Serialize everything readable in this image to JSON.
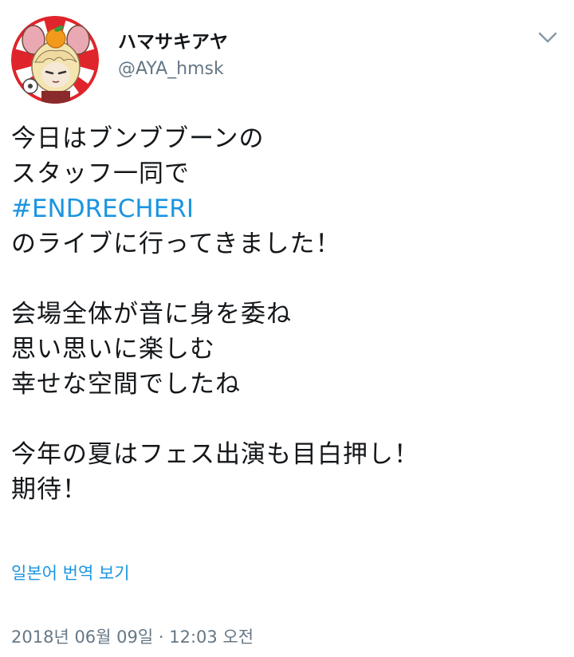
{
  "user": {
    "display_name": "ハマサキアヤ",
    "handle": "@AYA_hmsk",
    "avatar_icon": "profile-avatar",
    "avatar_colors": {
      "ring_red": "#e0242b",
      "ring_white": "#ffffff",
      "hair": "#f3e4b0",
      "orange": "#f29a1c",
      "leaf": "#3a9b3a",
      "ear": "#e9a8b2"
    }
  },
  "menu": {
    "icon": "chevron-down-icon",
    "color": "#8899a6"
  },
  "tweet": {
    "lines": [
      {
        "text": "今日はブンブブーンの"
      },
      {
        "text": "スタッフ一同で"
      },
      {
        "hashtag": "#ENDRECHERI"
      },
      {
        "text": "のライブに行ってきました！"
      },
      {
        "blank": true
      },
      {
        "text": "会場全体が音に身を委ね"
      },
      {
        "text": "思い思いに楽しむ"
      },
      {
        "text": "幸せな空間でしたね"
      },
      {
        "blank": true
      },
      {
        "text": "今年の夏はフェス出演も目白押し！"
      },
      {
        "text": "期待！"
      }
    ],
    "hashtag_color": "#1b95e0"
  },
  "translate": {
    "label": "일본어 번역 보기"
  },
  "timestamp": {
    "text": "2018년 06월 09일 · 12:03 오전"
  }
}
